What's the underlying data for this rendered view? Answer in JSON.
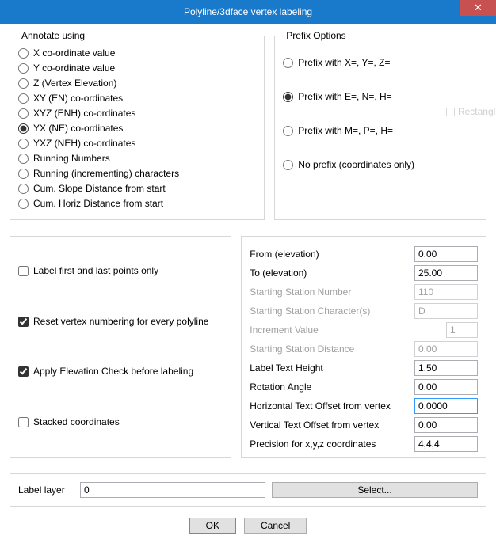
{
  "window": {
    "title": "Polyline/3dface vertex labeling"
  },
  "annotate": {
    "legend": "Annotate using",
    "options": [
      "X co-ordinate value",
      "Y co-ordinate value",
      "Z (Vertex Elevation)",
      "XY (EN) co-ordinates",
      "XYZ (ENH) co-ordinates",
      "YX (NE) co-ordinates",
      "YXZ (NEH) co-ordinates",
      "Running Numbers",
      "Running (incrementing) characters",
      "Cum. Slope Distance from start",
      "Cum. Horiz Distance from start"
    ],
    "selected": 5
  },
  "prefix": {
    "legend": "Prefix Options",
    "options": [
      "Prefix with X=, Y=, Z=",
      "Prefix with E=, N=, H=",
      "Prefix with M=, P=, H=",
      "No prefix (coordinates only)"
    ],
    "selected": 1
  },
  "checks": {
    "label_first_last": {
      "label": "Label first and last points only",
      "checked": false
    },
    "reset_numbering": {
      "label": "Reset vertex numbering for every polyline",
      "checked": true
    },
    "elev_check": {
      "label": "Apply Elevation Check before labeling",
      "checked": true
    },
    "stacked": {
      "label": "Stacked coordinates",
      "checked": false
    }
  },
  "fields": {
    "from_elev": {
      "label": "From (elevation)",
      "value": "0.00",
      "enabled": true
    },
    "to_elev": {
      "label": "To (elevation)",
      "value": "25.00",
      "enabled": true
    },
    "start_num": {
      "label": "Starting Station Number",
      "value": "110",
      "enabled": false
    },
    "start_char": {
      "label": "Starting Station Character(s)",
      "value": "D",
      "enabled": false
    },
    "incr_val": {
      "label": "Increment Value",
      "value": "1",
      "enabled": false,
      "small": true
    },
    "start_dist": {
      "label": "Starting Station Distance",
      "value": "0.00",
      "enabled": false
    },
    "text_height": {
      "label": "Label Text Height",
      "value": "1.50",
      "enabled": true
    },
    "rot_angle": {
      "label": "Rotation Angle",
      "value": "0.00",
      "enabled": true
    },
    "h_offset": {
      "label": "Horizontal Text Offset from vertex",
      "value": "0.0000",
      "enabled": true,
      "focused": true
    },
    "v_offset": {
      "label": "Vertical Text Offset from vertex",
      "value": "0.00",
      "enabled": true
    },
    "precision": {
      "label": "Precision for x,y,z coordinates",
      "value": "4,4,4",
      "enabled": true
    }
  },
  "layer": {
    "label": "Label layer",
    "value": "0",
    "select_btn": "Select..."
  },
  "buttons": {
    "ok": "OK",
    "cancel": "Cancel"
  },
  "ghost": "Rectangle"
}
